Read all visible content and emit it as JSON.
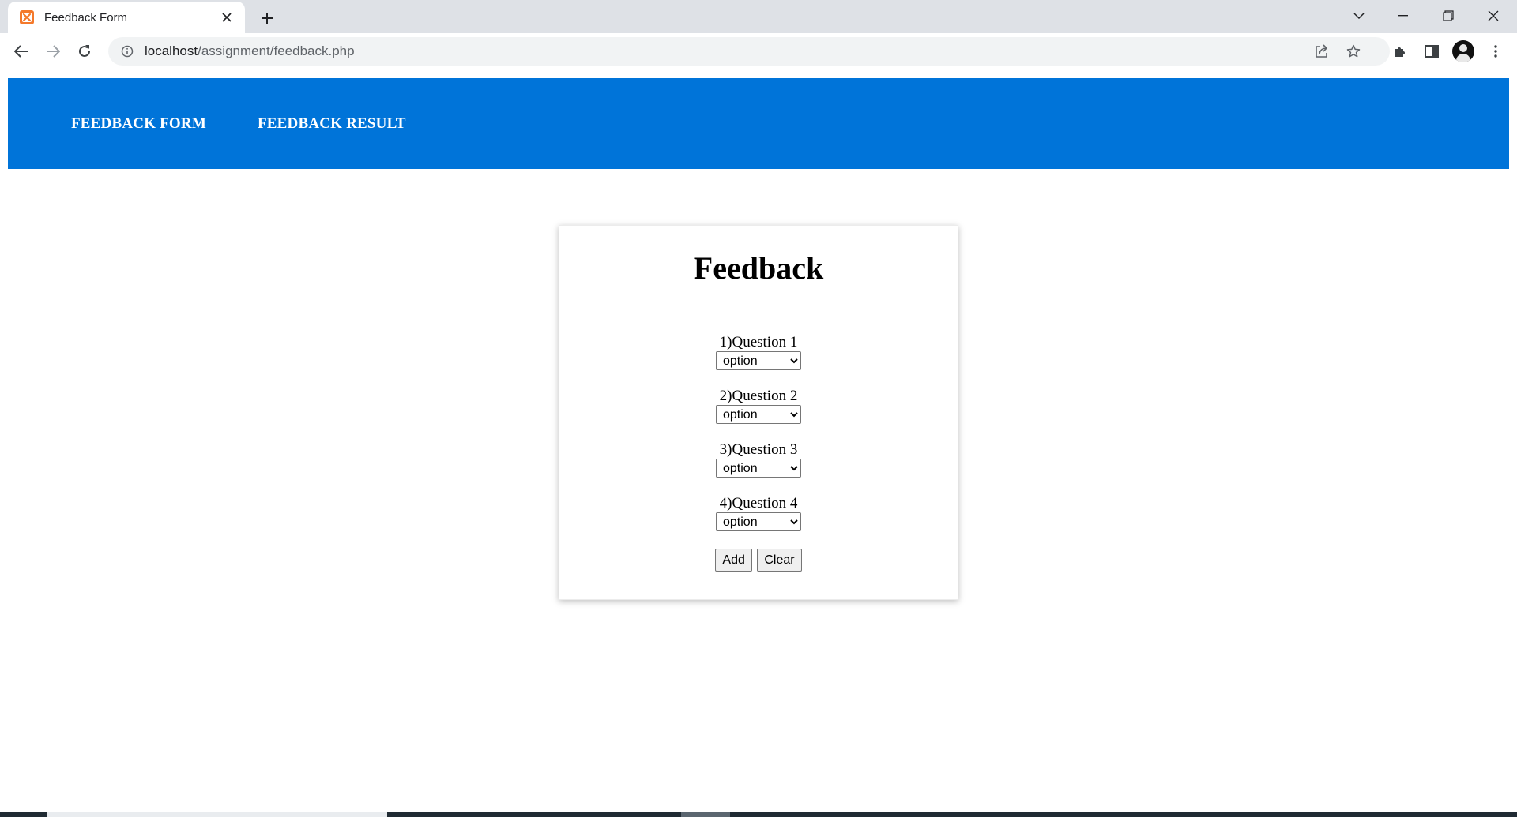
{
  "browser": {
    "tab_title": "Feedback Form",
    "url_host": "localhost",
    "url_path": "/assignment/feedback.php",
    "favicon": "xampp-icon",
    "accent": "#f4792b"
  },
  "navbar": {
    "color": "#0074d9",
    "links": [
      {
        "label": "FEEDBACK FORM"
      },
      {
        "label": "FEEDBACK RESULT"
      }
    ]
  },
  "form": {
    "title": "Feedback",
    "questions": [
      {
        "label": "1)Question 1",
        "selected": "option"
      },
      {
        "label": "2)Question 2",
        "selected": "option"
      },
      {
        "label": "3)Question 3",
        "selected": "option"
      },
      {
        "label": "4)Question 4",
        "selected": "option"
      }
    ],
    "add_label": "Add",
    "clear_label": "Clear"
  }
}
